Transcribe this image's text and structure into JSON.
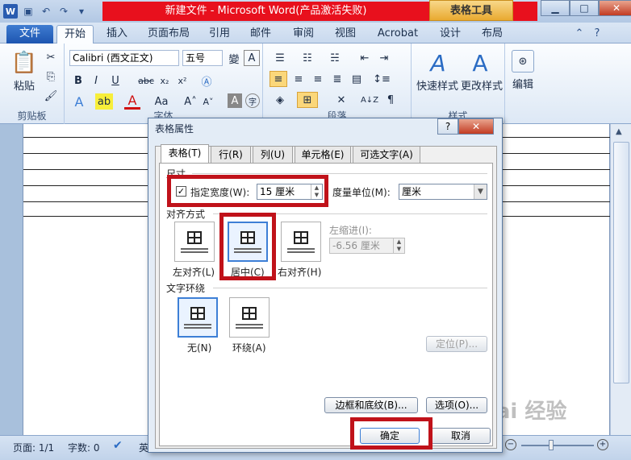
{
  "title_bar": {
    "title": "新建文件 - Microsoft Word(产品激活失败)",
    "context_tab": "表格工具",
    "minimize": "▁",
    "maximize": "□",
    "close": "✕"
  },
  "ribbon_tabs": [
    "文件",
    "开始",
    "插入",
    "页面布局",
    "引用",
    "邮件",
    "审阅",
    "视图",
    "Acrobat",
    "设计",
    "布局"
  ],
  "ribbon": {
    "font_name": "Calibri (西文正文)",
    "font_size": "五号",
    "paste_label": "粘贴",
    "clipboard_label": "剪贴板",
    "font_group_label": "字体",
    "paragraph_group_label": "段落",
    "styles_label": "样式",
    "quick_styles_label": "快速样式",
    "change_styles_label": "更改样式",
    "edit_label": "编辑"
  },
  "status_bar": {
    "page": "页面: 1/1",
    "words": "字数: 0",
    "lang": "英"
  },
  "dialog": {
    "title": "表格属性",
    "help": "?",
    "close": "✕",
    "tabs": [
      "表格(T)",
      "行(R)",
      "列(U)",
      "单元格(E)",
      "可选文字(A)"
    ],
    "size_section": "尺寸",
    "specify_width_label": "指定宽度(W):",
    "width_value": "15 厘米",
    "measure_in_label": "度量单位(M):",
    "measure_in_value": "厘米",
    "alignment_section": "对齐方式",
    "align_left": "左对齐(L)",
    "align_center": "居中(C)",
    "align_right": "右对齐(H)",
    "indent_label": "左缩进(I):",
    "indent_value": "-6.56 厘米",
    "wrap_section": "文字环绕",
    "wrap_none": "无(N)",
    "wrap_around": "环绕(A)",
    "positioning_button": "定位(P)...",
    "borders_button": "边框和底纹(B)...",
    "options_button": "选项(O)...",
    "ok_button": "确定",
    "cancel_button": "取消"
  },
  "watermark": "Bai 经验",
  "colors": {
    "highlight_red": "#c0121a",
    "title_red": "#e8101d",
    "file_tab": "#1d55b0"
  }
}
